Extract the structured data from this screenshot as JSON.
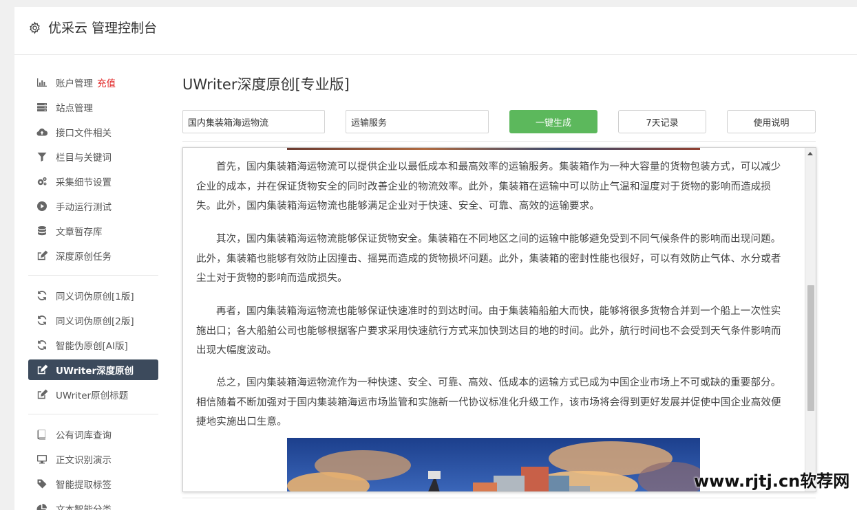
{
  "header": {
    "title": "优采云 管理控制台",
    "icon": "gear-icon"
  },
  "sidebar": {
    "group1": [
      {
        "label": "账户管理",
        "badge": "充值",
        "icon": "bar-chart-icon"
      },
      {
        "label": "站点管理",
        "icon": "server-icon"
      },
      {
        "label": "接口文件相关",
        "icon": "cloud-upload-icon"
      },
      {
        "label": "栏目与关键词",
        "icon": "filter-icon"
      },
      {
        "label": "采集细节设置",
        "icon": "cogs-icon"
      },
      {
        "label": "手动运行测试",
        "icon": "play-circle-icon"
      },
      {
        "label": "文章暂存库",
        "icon": "database-icon"
      },
      {
        "label": "深度原创任务",
        "icon": "edit-icon"
      }
    ],
    "group2": [
      {
        "label": "同义词伪原创[1版]",
        "icon": "refresh-icon"
      },
      {
        "label": "同义词伪原创[2版]",
        "icon": "refresh-icon"
      },
      {
        "label": "智能伪原创[AI版]",
        "icon": "refresh-icon"
      },
      {
        "label": "UWriter深度原创",
        "icon": "edit-icon",
        "active": true
      },
      {
        "label": "UWriter原创标题",
        "icon": "edit-icon"
      }
    ],
    "group3": [
      {
        "label": "公有词库查询",
        "icon": "book-icon"
      },
      {
        "label": "正文识别演示",
        "icon": "desktop-icon"
      },
      {
        "label": "智能提取标签",
        "icon": "tag-icon"
      },
      {
        "label": "文本智能分类",
        "icon": "pie-chart-icon"
      }
    ]
  },
  "main": {
    "title": "UWriter深度原创[专业版]",
    "keyword_input": "国内集装箱海运物流",
    "second_input": "运输服务",
    "generate_label": "一键生成",
    "history_label": "7天记录",
    "help_label": "使用说明",
    "paragraphs": [
      "首先，国内集装箱海运物流可以提供企业以最低成本和最高效率的运输服务。集装箱作为一种大容量的货物包装方式，可以减少企业的成本，并在保证货物安全的同时改善企业的物流效率。此外，集装箱在运输中可以防止气温和湿度对于货物的影响而造成损失。此外，国内集装箱海运物流也能够满足企业对于快速、安全、可靠、高效的运输要求。",
      "其次，国内集装箱海运物流能够保证货物安全。集装箱在不同地区之间的运输中能够避免受到不同气候条件的影响而出现问题。此外，集装箱也能够有效防止因撞击、摇晃而造成的货物损坏问题。此外，集装箱的密封性能也很好，可以有效防止气体、水分或者尘土对于货物的影响而造成损失。",
      "再者，国内集装箱海运物流也能够保证快速准时的到达时间。由于集装箱船舶大而快，能够将很多货物合并到一个船上一次性实施出口；各大船舶公司也能够根据客户要求采用快速航行方式来加快到达目的地的时间。此外，航行时间也不会受到天气条件影响而出现大幅度波动。",
      "总之，国内集装箱海运物流作为一种快速、安全、可靠、高效、低成本的运输方式已成为中国企业市场上不可或缺的重要部分。相信随着不断加强对于国内集装箱海运市场监管和实施新一代协议标准化升级工作，该市场将会得到更好发展并促使中国企业高效便捷地实施出口生意。"
    ]
  },
  "watermark": "www.rjtj.cn软荐网",
  "colors": {
    "primary": "#5cb85c",
    "active_nav": "#3c4a5c",
    "badge": "#e02020"
  }
}
